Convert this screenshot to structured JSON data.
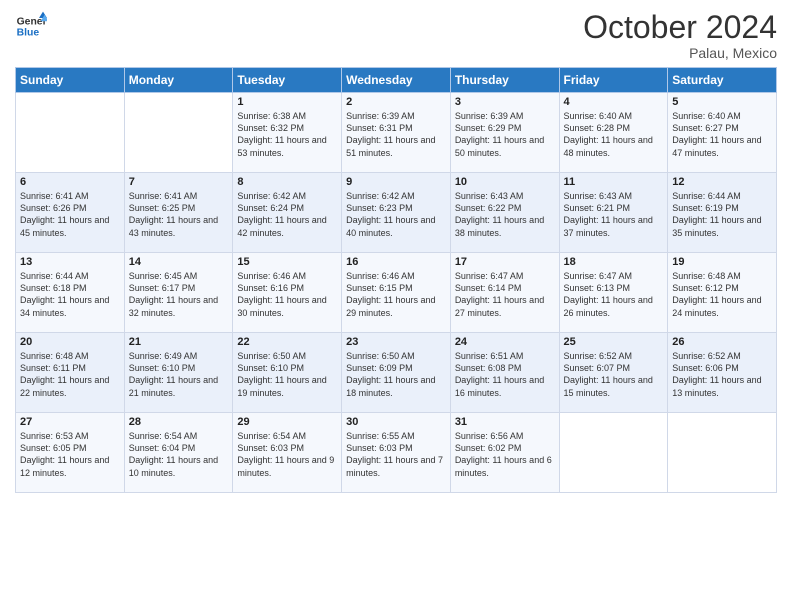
{
  "logo": {
    "line1": "General",
    "line2": "Blue"
  },
  "title": "October 2024",
  "subtitle": "Palau, Mexico",
  "days_of_week": [
    "Sunday",
    "Monday",
    "Tuesday",
    "Wednesday",
    "Thursday",
    "Friday",
    "Saturday"
  ],
  "weeks": [
    [
      {
        "day": "",
        "info": ""
      },
      {
        "day": "",
        "info": ""
      },
      {
        "day": "1",
        "info": "Sunrise: 6:38 AM\nSunset: 6:32 PM\nDaylight: 11 hours and 53 minutes."
      },
      {
        "day": "2",
        "info": "Sunrise: 6:39 AM\nSunset: 6:31 PM\nDaylight: 11 hours and 51 minutes."
      },
      {
        "day": "3",
        "info": "Sunrise: 6:39 AM\nSunset: 6:29 PM\nDaylight: 11 hours and 50 minutes."
      },
      {
        "day": "4",
        "info": "Sunrise: 6:40 AM\nSunset: 6:28 PM\nDaylight: 11 hours and 48 minutes."
      },
      {
        "day": "5",
        "info": "Sunrise: 6:40 AM\nSunset: 6:27 PM\nDaylight: 11 hours and 47 minutes."
      }
    ],
    [
      {
        "day": "6",
        "info": "Sunrise: 6:41 AM\nSunset: 6:26 PM\nDaylight: 11 hours and 45 minutes."
      },
      {
        "day": "7",
        "info": "Sunrise: 6:41 AM\nSunset: 6:25 PM\nDaylight: 11 hours and 43 minutes."
      },
      {
        "day": "8",
        "info": "Sunrise: 6:42 AM\nSunset: 6:24 PM\nDaylight: 11 hours and 42 minutes."
      },
      {
        "day": "9",
        "info": "Sunrise: 6:42 AM\nSunset: 6:23 PM\nDaylight: 11 hours and 40 minutes."
      },
      {
        "day": "10",
        "info": "Sunrise: 6:43 AM\nSunset: 6:22 PM\nDaylight: 11 hours and 38 minutes."
      },
      {
        "day": "11",
        "info": "Sunrise: 6:43 AM\nSunset: 6:21 PM\nDaylight: 11 hours and 37 minutes."
      },
      {
        "day": "12",
        "info": "Sunrise: 6:44 AM\nSunset: 6:19 PM\nDaylight: 11 hours and 35 minutes."
      }
    ],
    [
      {
        "day": "13",
        "info": "Sunrise: 6:44 AM\nSunset: 6:18 PM\nDaylight: 11 hours and 34 minutes."
      },
      {
        "day": "14",
        "info": "Sunrise: 6:45 AM\nSunset: 6:17 PM\nDaylight: 11 hours and 32 minutes."
      },
      {
        "day": "15",
        "info": "Sunrise: 6:46 AM\nSunset: 6:16 PM\nDaylight: 11 hours and 30 minutes."
      },
      {
        "day": "16",
        "info": "Sunrise: 6:46 AM\nSunset: 6:15 PM\nDaylight: 11 hours and 29 minutes."
      },
      {
        "day": "17",
        "info": "Sunrise: 6:47 AM\nSunset: 6:14 PM\nDaylight: 11 hours and 27 minutes."
      },
      {
        "day": "18",
        "info": "Sunrise: 6:47 AM\nSunset: 6:13 PM\nDaylight: 11 hours and 26 minutes."
      },
      {
        "day": "19",
        "info": "Sunrise: 6:48 AM\nSunset: 6:12 PM\nDaylight: 11 hours and 24 minutes."
      }
    ],
    [
      {
        "day": "20",
        "info": "Sunrise: 6:48 AM\nSunset: 6:11 PM\nDaylight: 11 hours and 22 minutes."
      },
      {
        "day": "21",
        "info": "Sunrise: 6:49 AM\nSunset: 6:10 PM\nDaylight: 11 hours and 21 minutes."
      },
      {
        "day": "22",
        "info": "Sunrise: 6:50 AM\nSunset: 6:10 PM\nDaylight: 11 hours and 19 minutes."
      },
      {
        "day": "23",
        "info": "Sunrise: 6:50 AM\nSunset: 6:09 PM\nDaylight: 11 hours and 18 minutes."
      },
      {
        "day": "24",
        "info": "Sunrise: 6:51 AM\nSunset: 6:08 PM\nDaylight: 11 hours and 16 minutes."
      },
      {
        "day": "25",
        "info": "Sunrise: 6:52 AM\nSunset: 6:07 PM\nDaylight: 11 hours and 15 minutes."
      },
      {
        "day": "26",
        "info": "Sunrise: 6:52 AM\nSunset: 6:06 PM\nDaylight: 11 hours and 13 minutes."
      }
    ],
    [
      {
        "day": "27",
        "info": "Sunrise: 6:53 AM\nSunset: 6:05 PM\nDaylight: 11 hours and 12 minutes."
      },
      {
        "day": "28",
        "info": "Sunrise: 6:54 AM\nSunset: 6:04 PM\nDaylight: 11 hours and 10 minutes."
      },
      {
        "day": "29",
        "info": "Sunrise: 6:54 AM\nSunset: 6:03 PM\nDaylight: 11 hours and 9 minutes."
      },
      {
        "day": "30",
        "info": "Sunrise: 6:55 AM\nSunset: 6:03 PM\nDaylight: 11 hours and 7 minutes."
      },
      {
        "day": "31",
        "info": "Sunrise: 6:56 AM\nSunset: 6:02 PM\nDaylight: 11 hours and 6 minutes."
      },
      {
        "day": "",
        "info": ""
      },
      {
        "day": "",
        "info": ""
      }
    ]
  ]
}
